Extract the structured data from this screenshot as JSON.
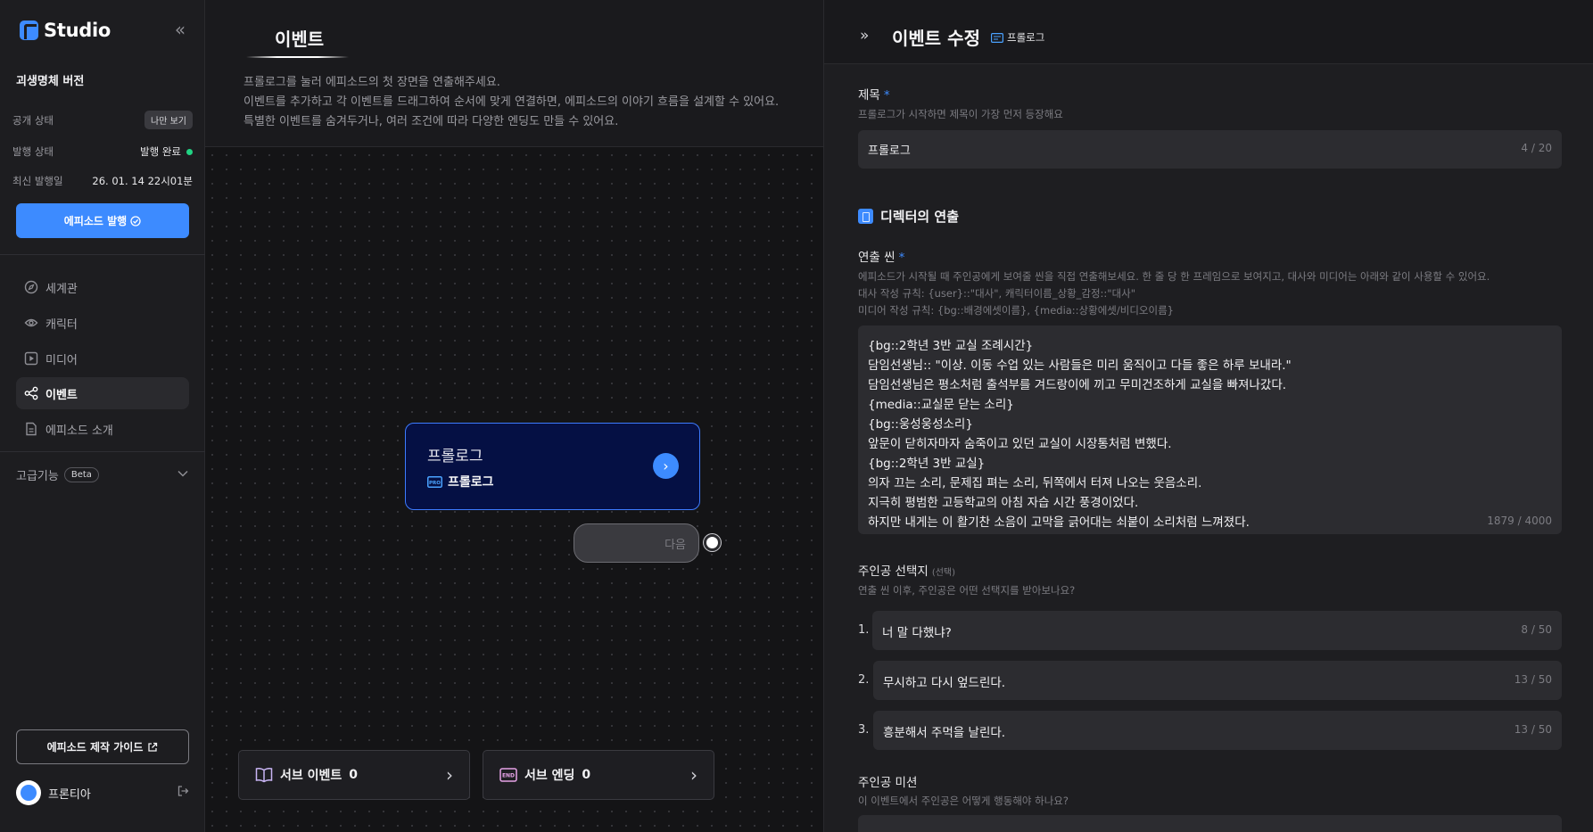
{
  "sidebar": {
    "logo_text": "Studio",
    "project_title": "괴생명체 버전",
    "visibility_label": "공개 상태",
    "visibility_value": "나만 보기",
    "publish_status_label": "발행 상태",
    "publish_status_value": "발행 완료",
    "last_published_label": "최신 발행일",
    "last_published_value": "26. 01. 14 22시01분",
    "publish_button": "에피소드 발행",
    "nav": [
      {
        "label": "세계관",
        "icon": "compass-icon"
      },
      {
        "label": "캐릭터",
        "icon": "character-icon"
      },
      {
        "label": "미디어",
        "icon": "media-play-icon"
      },
      {
        "label": "이벤트",
        "icon": "share-nodes-icon"
      },
      {
        "label": "에피소드 소개",
        "icon": "document-icon"
      }
    ],
    "advanced_label": "고급기능",
    "beta_label": "Beta",
    "guide_button": "에피소드 제작 가이드",
    "user_name": "프론티아"
  },
  "center": {
    "title": "이벤트",
    "desc_lines": [
      "프롤로그를 눌러 에피소드의 첫 장면을 연출해주세요.",
      "이벤트를 추가하고 각 이벤트를 드래그하여 순서에 맞게 연결하면, 에피소드의 이야기 흐름을 설계할 수 있어요.",
      "특별한 이벤트를 숨겨두거나, 여러 조건에 따라 다양한 엔딩도 만들 수 있어요."
    ],
    "node_title": "프롤로그",
    "node_tag_icon": "PRO",
    "node_subtitle": "프롤로그",
    "next_label": "다음",
    "sub_event_label": "서브 이벤트",
    "sub_event_count": "0",
    "sub_ending_label": "서브 엔딩",
    "sub_ending_icon": "END",
    "sub_ending_count": "0"
  },
  "panel": {
    "title": "이벤트 수정",
    "tag_label": "프롤로그",
    "title_field_label": "제목",
    "title_field_help": "프롤로그가 시작하면 제목이 가장 먼저 등장해요",
    "title_field_value": "프롤로그",
    "title_field_count": "4 / 20",
    "section_title": "디렉터의 연출",
    "scene_label": "연출 씬",
    "scene_help": [
      "에피소드가 시작될 때 주인공에게 보여줄 씬을 직접 연출해보세요. 한 줄 당 한 프레임으로 보여지고, 대사와 미디어는 아래와 같이 사용할 수 있어요.",
      "대사 작성 규칙: {user}::\"대사\", 캐릭터이름_상황_감정::\"대사\"",
      "미디어 작성 규칙: {bg::배경에셋이름}, {media::상황에셋/비디오이름}"
    ],
    "scene_lines": [
      "{bg::2학년 3반 교실 조례시간}",
      "담임선생님:: \"이상. 이동 수업 있는 사람들은 미리 움직이고 다들 좋은 하루 보내라.\"",
      "담임선생님은 평소처럼 출석부를 겨드랑이에 끼고 무미건조하게 교실을 빠져나갔다.",
      "{media::교실문 닫는 소리}",
      "{bg::웅성웅성소리}",
      "앞문이 닫히자마자 숨죽이고 있던 교실이 시장통처럼 변했다.",
      "{bg::2학년 3반 교실}",
      "의자 끄는 소리, 문제집 펴는 소리, 뒤쪽에서 터져 나오는 웃음소리.",
      "지극히 평범한 고등학교의 아침 자습 시간 풍경이었다.",
      "하지만 내게는 이 활기찬 소음이 고막을 긁어대는 쇠붙이 소리처럼 느껴졌다."
    ],
    "scene_count": "1879 / 4000",
    "choice_label": "주인공 선택지",
    "choice_optional": "(선택)",
    "choice_help": "연출 씬 이후, 주인공은 어떤 선택지를 받아보나요?",
    "choices": [
      {
        "num": "1.",
        "text": "너 말 다했냐?",
        "count": "8 / 50"
      },
      {
        "num": "2.",
        "text": "무시하고 다시 엎드린다.",
        "count": "13 / 50"
      },
      {
        "num": "3.",
        "text": "흥분해서 주먹을 날린다.",
        "count": "13 / 50"
      }
    ],
    "mission_label": "주인공 미션",
    "mission_help": "이 이벤트에서 주인공은 어떻게 행동해야 하나요?"
  },
  "colors": {
    "accent": "#3d8bff",
    "status_green": "#21d383",
    "node_bg": "#051044"
  }
}
